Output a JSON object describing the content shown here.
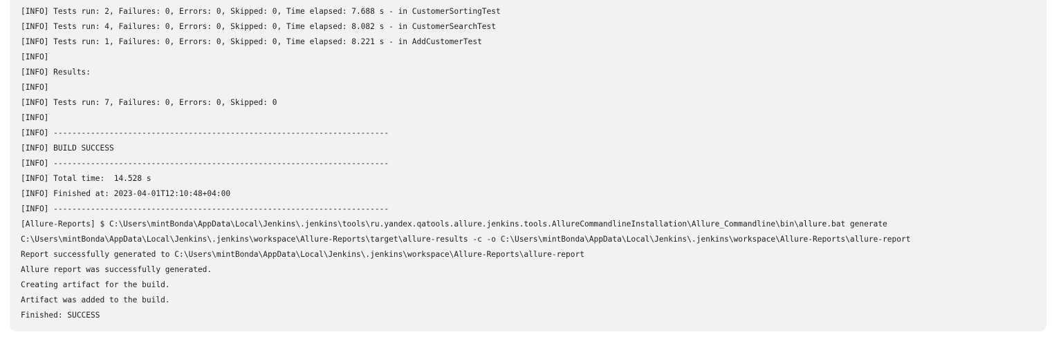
{
  "console": {
    "lines": [
      "[INFO] Tests run: 2, Failures: 0, Errors: 0, Skipped: 0, Time elapsed: 7.688 s - in CustomerSortingTest",
      "[INFO] Tests run: 4, Failures: 0, Errors: 0, Skipped: 0, Time elapsed: 8.082 s - in CustomerSearchTest",
      "[INFO] Tests run: 1, Failures: 0, Errors: 0, Skipped: 0, Time elapsed: 8.221 s - in AddCustomerTest",
      "[INFO]",
      "[INFO] Results:",
      "[INFO]",
      "[INFO] Tests run: 7, Failures: 0, Errors: 0, Skipped: 0",
      "[INFO]",
      "[INFO] ------------------------------------------------------------------------",
      "[INFO] BUILD SUCCESS",
      "[INFO] ------------------------------------------------------------------------",
      "[INFO] Total time:  14.528 s",
      "[INFO] Finished at: 2023-04-01T12:10:48+04:00",
      "[INFO] ------------------------------------------------------------------------",
      "[Allure-Reports] $ C:\\Users\\mintBonda\\AppData\\Local\\Jenkins\\.jenkins\\tools\\ru.yandex.qatools.allure.jenkins.tools.AllureCommandlineInstallation\\Allure_Commandline\\bin\\allure.bat generate",
      "C:\\Users\\mintBonda\\AppData\\Local\\Jenkins\\.jenkins\\workspace\\Allure-Reports\\target\\allure-results -c -o C:\\Users\\mintBonda\\AppData\\Local\\Jenkins\\.jenkins\\workspace\\Allure-Reports\\allure-report",
      "Report successfully generated to C:\\Users\\mintBonda\\AppData\\Local\\Jenkins\\.jenkins\\workspace\\Allure-Reports\\allure-report",
      "Allure report was successfully generated.",
      "Creating artifact for the build.",
      "Artifact was added to the build.",
      "Finished: SUCCESS"
    ]
  }
}
